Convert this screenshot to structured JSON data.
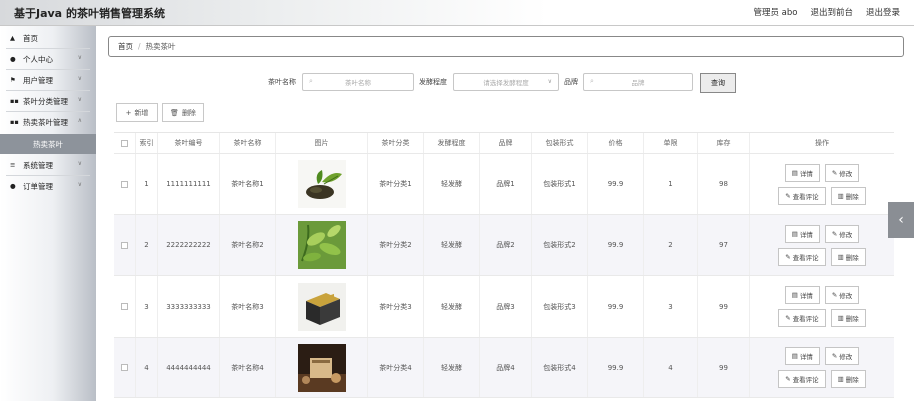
{
  "app": {
    "title": "基于Java 的茶叶销售管理系统"
  },
  "top_links": {
    "user": "管理员 abo",
    "front": "退出到前台",
    "logout": "退出登录"
  },
  "sidebar": {
    "items": [
      {
        "label": "首页",
        "icon": "home-icon"
      },
      {
        "label": "个人中心",
        "icon": "user-icon"
      },
      {
        "label": "用户管理",
        "icon": "flag-icon"
      },
      {
        "label": "茶叶分类管理",
        "icon": "grid-icon"
      },
      {
        "label": "热卖茶叶管理",
        "icon": "grid-icon"
      },
      {
        "label": "热卖茶叶",
        "icon": ""
      },
      {
        "label": "系统管理",
        "icon": "list-icon"
      },
      {
        "label": "订单管理",
        "icon": "user-icon"
      }
    ]
  },
  "breadcrumb": {
    "home": "首页",
    "sep": "/",
    "current": "热卖茶叶"
  },
  "search": {
    "name_label": "茶叶名称",
    "name_placeholder": "茶叶名称",
    "ferment_label": "发酵程度",
    "ferment_placeholder": "请选择发酵程度",
    "brand_label": "品牌",
    "brand_placeholder": "品牌",
    "query": "查询"
  },
  "actions": {
    "add": "新增",
    "delete": "删除"
  },
  "table": {
    "headers": [
      "索引",
      "茶叶编号",
      "茶叶名称",
      "图片",
      "茶叶分类",
      "发酵程度",
      "品牌",
      "包装形式",
      "价格",
      "单限",
      "库存",
      "操作"
    ],
    "rows": [
      {
        "index": "1",
        "code": "1111111111",
        "name": "茶叶名称1",
        "category": "茶叶分类1",
        "ferment": "轻发酵",
        "brand": "品牌1",
        "pack": "包装形式1",
        "price": "99.9",
        "limit": "1",
        "stock": "98"
      },
      {
        "index": "2",
        "code": "2222222222",
        "name": "茶叶名称2",
        "category": "茶叶分类2",
        "ferment": "轻发酵",
        "brand": "品牌2",
        "pack": "包装形式2",
        "price": "99.9",
        "limit": "2",
        "stock": "97"
      },
      {
        "index": "3",
        "code": "3333333333",
        "name": "茶叶名称3",
        "category": "茶叶分类3",
        "ferment": "轻发酵",
        "brand": "品牌3",
        "pack": "包装形式3",
        "price": "99.9",
        "limit": "3",
        "stock": "99"
      },
      {
        "index": "4",
        "code": "4444444444",
        "name": "茶叶名称4",
        "category": "茶叶分类4",
        "ferment": "轻发酵",
        "brand": "品牌4",
        "pack": "包装形式4",
        "price": "99.9",
        "limit": "4",
        "stock": "99"
      }
    ],
    "ops": {
      "detail": "详情",
      "edit": "修改",
      "review": "查看评论",
      "delete": "删除"
    }
  },
  "colors": {
    "active_menu": "#8d939b",
    "collapse_tab": "#8a8e94"
  }
}
